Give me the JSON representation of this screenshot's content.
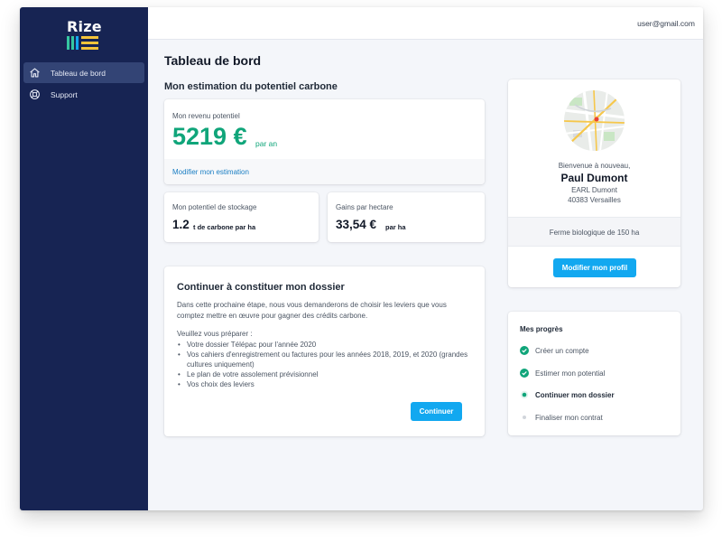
{
  "app": {
    "logo_text": "Rize",
    "brand_colors": {
      "sidebar": "#172453",
      "accent": "#12a8f0",
      "success": "#10a57a"
    }
  },
  "sidebar": {
    "items": [
      {
        "label": "Tableau de bord",
        "icon": "home-icon",
        "active": true
      },
      {
        "label": "Support",
        "icon": "lifebuoy-icon",
        "active": false
      }
    ]
  },
  "header": {
    "user_email": "user@gmail.com"
  },
  "main": {
    "title": "Tableau de bord",
    "estimation": {
      "section_title": "Mon estimation du potentiel carbone",
      "revenue": {
        "label": "Mon revenu potentiel",
        "value": "5219 €",
        "unit": "par an",
        "link": "Modifier mon estimation"
      },
      "stockage": {
        "label": "Mon potentiel de stockage",
        "value": "1.2",
        "unit": "t de carbone par ha"
      },
      "gains": {
        "label": "Gains par hectare",
        "value": "33,54 €",
        "unit": "par ha"
      }
    },
    "dossier": {
      "title": "Continuer à constituer mon dossier",
      "description": "Dans cette prochaine étape, nous vous demanderons de choisir les leviers que vous comptez mettre en œuvre pour gagner des crédits carbone.",
      "prepare": "Veuillez vous préparer :",
      "items": [
        "Votre dossier Télépac pour l'année 2020",
        "Vos cahiers d'enregistrement ou factures pour les années 2018, 2019, et 2020 (grandes cultures uniquement)",
        "Le plan de votre assolement prévisionnel",
        "Vos choix des leviers"
      ],
      "button": "Continuer"
    }
  },
  "profile": {
    "greeting": "Bienvenue à nouveau,",
    "name": "Paul Dumont",
    "company": "EARL Dumont",
    "city": "40383 Versailles",
    "farm": "Ferme biologique de 150 ha",
    "button": "Modifier mon profil"
  },
  "progress": {
    "title": "Mes progrès",
    "steps": [
      {
        "label": "Créer un compte",
        "status": "done",
        "icon": "check-circle-icon"
      },
      {
        "label": "Estimer mon potential",
        "status": "done",
        "icon": "check-circle-icon"
      },
      {
        "label": "Continuer mon dossier",
        "status": "current",
        "icon": "dot-icon"
      },
      {
        "label": "Finaliser mon contrat",
        "status": "pending",
        "icon": "dot-icon"
      }
    ]
  }
}
